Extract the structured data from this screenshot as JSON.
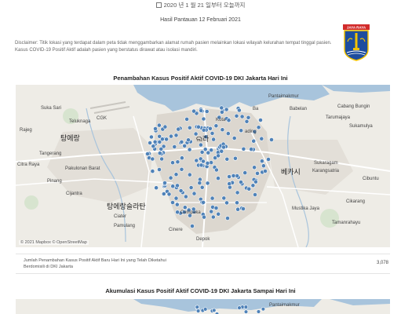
{
  "header": {
    "date_text": "2020 년 1 월 21 일부터 오늘까지",
    "subtitle": "Hasil Pantauan 12 Februari 2021",
    "disclaimer": "Disclaimer: Titik lokasi yang terdapat dalam peta tidak menggambarkan alamat rumah pasien melainkan lokasi wilayah kelurahan tempat tinggal pasien. Kasus COVID-19 Positif Aktif adalah pasien yang berstatus dirawat atau isolasi mandiri."
  },
  "logo": {
    "icon": "jakarta-emblem-icon",
    "banner_text": "JAYA RAYA",
    "colors": {
      "shield": "#1d4d9e",
      "banner": "#d22b2b",
      "gold": "#f2c200"
    }
  },
  "map1": {
    "title": "Penambahan Kasus Positif Aktif COVID-19 DKI Jakarta Hari Ini",
    "attribution": "© 2021 Mapbox  © OpenStreetMap",
    "labels": [
      "Suka Sari",
      "Teluknaga",
      "Pantaimakmur",
      "Sukamulya",
      "Cabang Bungin",
      "CGK",
      "Ba",
      "Kota",
      "ading",
      "탕에랑",
      "ଲ라",
      "Citra Raya",
      "Pakulonan Barat",
      "Cijantra",
      "탕에랑슬라탄",
      "Ciater",
      "Pamulang",
      "Cinere",
      "Babelan",
      "Tarumajaya",
      "Sukaragam",
      "Karangsatria",
      "베카시",
      "Cikarang",
      "Cibuntu",
      "Mustika Jaya",
      "Tamanrahayu",
      "Depok",
      "Rajeg",
      "Tangerang",
      "Pinang",
      "Cempaka"
    ],
    "colors": {
      "water": "#a8c4dc",
      "land": "#eeece6",
      "urban": "#d9d4cc",
      "road": "#ffffff",
      "marker": "#4f82b8"
    }
  },
  "stat": {
    "label": "Jumlah Penambahan Kasus Positif Aktif Baru Hari Ini yang Telah Diketahui Berdomisili di DKI Jakarta",
    "value": "3,078"
  },
  "map2": {
    "title": "Akumulasi Kasus Positif Aktif COVID-19 DKI Jakarta Sampai Hari Ini",
    "labels": [
      "Pantaimakmur"
    ]
  }
}
